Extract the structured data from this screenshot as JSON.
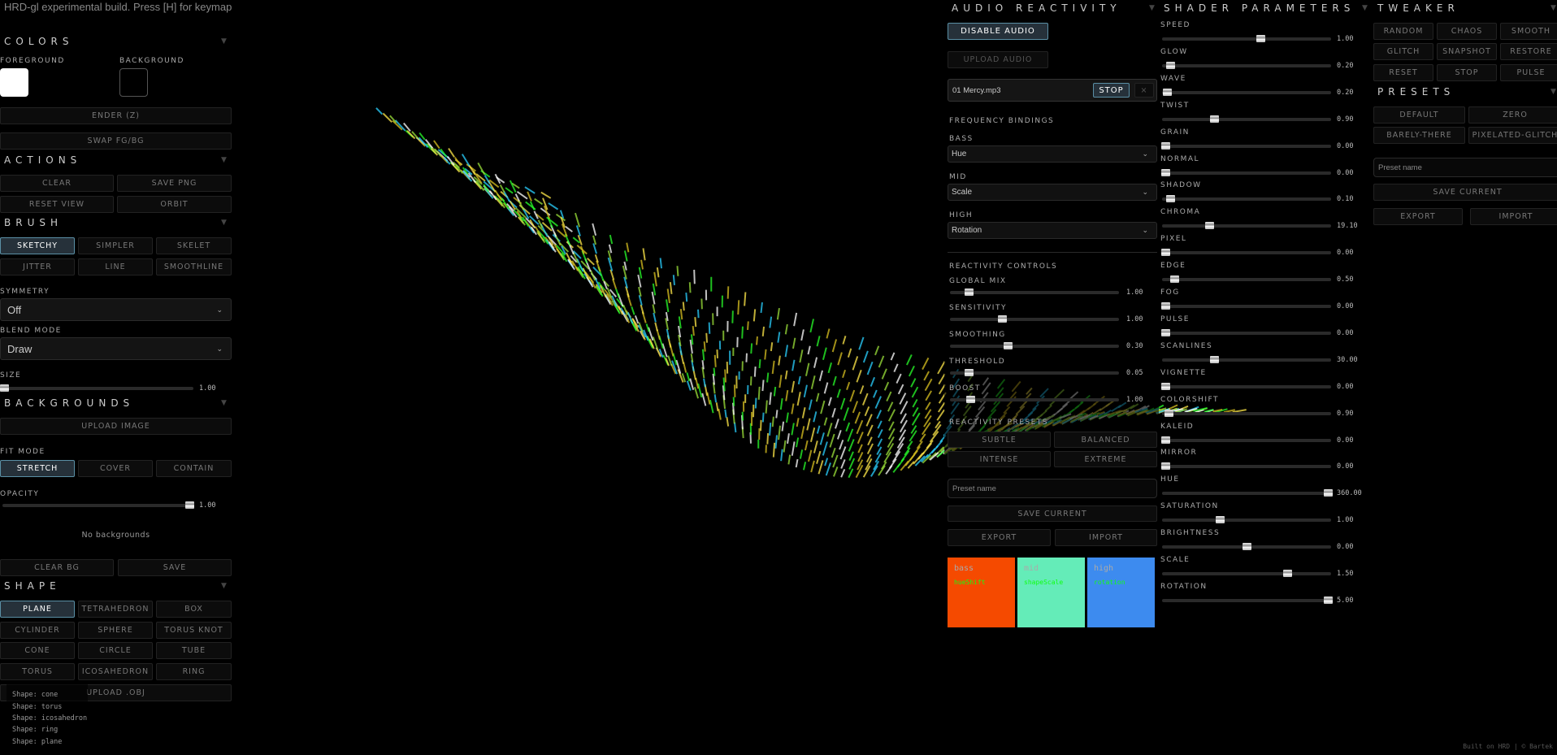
{
  "app_title": "HRD-gl experimental build. Press [H] for keymap",
  "footer": "Built on HRD | © Bartek",
  "colors": {
    "header": "COLORS",
    "foreground_label": "FOREGROUND",
    "background_label": "BACKGROUND",
    "foreground": "#ffffff",
    "background": "#000000",
    "render_button": "ENDER (Z)",
    "swap_button": "SWAP FG/BG"
  },
  "actions": {
    "header": "ACTIONS",
    "buttons": [
      "CLEAR",
      "SAVE PNG",
      "RESET VIEW",
      "ORBIT"
    ]
  },
  "brush": {
    "header": "BRUSH",
    "buttons": [
      "SKETCHY",
      "SIMPLER",
      "SKELET",
      "JITTER",
      "LINE",
      "SMOOTHLINE"
    ],
    "active": "SKETCHY",
    "symmetry_label": "SYMMETRY",
    "symmetry": "Off",
    "blend_label": "BLEND MODE",
    "blend": "Draw",
    "size_label": "SIZE",
    "size": "1.00",
    "size_level": 0.01
  },
  "backgrounds": {
    "header": "BACKGROUNDS",
    "upload": "UPLOAD IMAGE",
    "fit_label": "FIT MODE",
    "fit_buttons": [
      "STRETCH",
      "COVER",
      "CONTAIN"
    ],
    "opacity_label": "OPACITY",
    "opacity": "1.00",
    "opacity_level": 0.98,
    "empty": "No backgrounds",
    "clear": "CLEAR BG",
    "save": "SAVE"
  },
  "shape": {
    "header": "SHAPE",
    "buttons": [
      "PLANE",
      "TETRAHEDRON",
      "BOX",
      "CYLINDER",
      "SPHERE",
      "TORUS KNOT",
      "CONE",
      "CIRCLE",
      "TUBE",
      "TORUS",
      "ICOSAHEDRON",
      "RING"
    ],
    "active": "PLANE",
    "upload": "UPLOAD .OBJ",
    "log": [
      "Shape: cone",
      "Shape: torus",
      "Shape: icosahedron",
      "Shape: ring",
      "Shape: plane"
    ]
  },
  "audio": {
    "header": "AUDIO REACTIVITY",
    "disable": "DISABLE AUDIO",
    "upload": "UPLOAD AUDIO",
    "file": "01 Mercy.mp3",
    "stop": "STOP",
    "remove": "×",
    "freq_header": "FREQUENCY BINDINGS",
    "bindings": [
      {
        "label": "BASS",
        "value": "Hue"
      },
      {
        "label": "MID",
        "value": "Scale"
      },
      {
        "label": "HIGH",
        "value": "Rotation"
      }
    ],
    "controls_header": "REACTIVITY CONTROLS",
    "controls": [
      {
        "label": "GLOBAL MIX",
        "value": "1.00",
        "level": 0.11
      },
      {
        "label": "SENSITIVITY",
        "value": "1.00",
        "level": 0.31
      },
      {
        "label": "SMOOTHING",
        "value": "0.30",
        "level": 0.34
      },
      {
        "label": "THRESHOLD",
        "value": "0.05",
        "level": 0.11
      },
      {
        "label": "BOOST",
        "value": "1.00",
        "level": 0.12
      }
    ],
    "presets_header": "REACTIVITY PRESETS",
    "presets": [
      "SUBTLE",
      "BALANCED",
      "INTENSE",
      "EXTREME"
    ],
    "preset_placeholder": "Preset name",
    "save": "SAVE CURRENT",
    "export": "EXPORT",
    "import": "IMPORT",
    "bands": [
      {
        "name": "bass",
        "target": "hueShift",
        "color": "#f54a00"
      },
      {
        "name": "mid",
        "target": "shapeScale",
        "color": "#64ecb8"
      },
      {
        "name": "high",
        "target": "rotation",
        "color": "#3d8bef"
      }
    ]
  },
  "shader": {
    "header": "SHADER PARAMETERS",
    "params": [
      {
        "label": "SPEED",
        "value": "1.00",
        "level": 0.58
      },
      {
        "label": "GLOW",
        "value": "0.20",
        "level": 0.05
      },
      {
        "label": "WAVE",
        "value": "0.20",
        "level": 0.03
      },
      {
        "label": "TWIST",
        "value": "0.90",
        "level": 0.31
      },
      {
        "label": "GRAIN",
        "value": "0.00",
        "level": 0.02
      },
      {
        "label": "NORMAL",
        "value": "0.00",
        "level": 0.02
      },
      {
        "label": "SHADOW",
        "value": "0.10",
        "level": 0.05
      },
      {
        "label": "CHROMA",
        "value": "19.10",
        "level": 0.28
      },
      {
        "label": "PIXEL",
        "value": "0.00",
        "level": 0.02
      },
      {
        "label": "EDGE",
        "value": "0.50",
        "level": 0.07
      },
      {
        "label": "FOG",
        "value": "0.00",
        "level": 0.02
      },
      {
        "label": "PULSE",
        "value": "0.00",
        "level": 0.02
      },
      {
        "label": "SCANLINES",
        "value": "30.00",
        "level": 0.31
      },
      {
        "label": "VIGNETTE",
        "value": "0.00",
        "level": 0.02
      },
      {
        "label": "COLORSHIFT",
        "value": "0.90",
        "level": 0.04
      },
      {
        "label": "KALEID",
        "value": "0.00",
        "level": 0.02
      },
      {
        "label": "MIRROR",
        "value": "0.00",
        "level": 0.02
      },
      {
        "label": "HUE",
        "value": "360.00",
        "level": 0.98
      },
      {
        "label": "SATURATION",
        "value": "1.00",
        "level": 0.34
      },
      {
        "label": "BRIGHTNESS",
        "value": "0.00",
        "level": 0.5
      },
      {
        "label": "SCALE",
        "value": "1.50",
        "level": 0.74
      },
      {
        "label": "ROTATION",
        "value": "5.00",
        "level": 0.98
      }
    ]
  },
  "tweaker": {
    "header": "TWEAKER",
    "buttons": [
      "RANDOM",
      "CHAOS",
      "SMOOTH",
      "GLITCH",
      "SNAPSHOT",
      "RESTORE",
      "RESET",
      "STOP",
      "PULSE"
    ]
  },
  "presets": {
    "header": "PRESETS",
    "buttons": [
      "DEFAULT",
      "ZERO",
      "BARELY-THERE",
      "PIXELATED-GLITCH"
    ],
    "placeholder": "Preset name",
    "save": "SAVE CURRENT",
    "export": "EXPORT",
    "import": "IMPORT"
  }
}
